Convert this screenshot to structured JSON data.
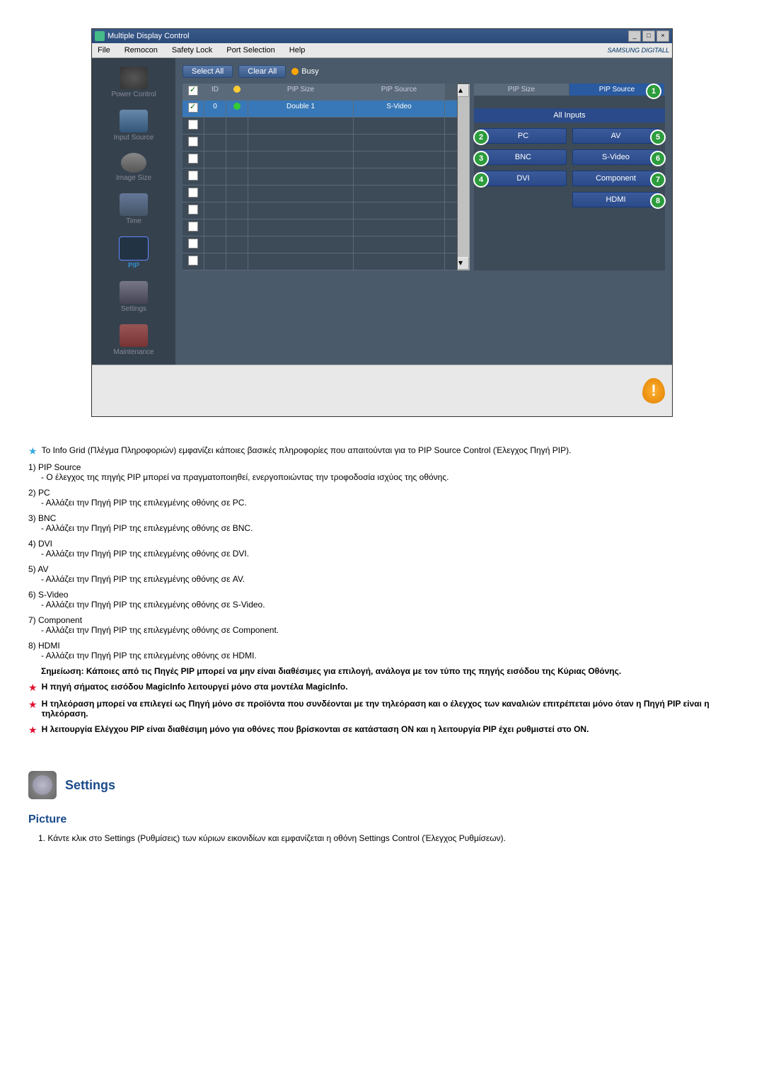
{
  "window": {
    "title": "Multiple Display Control",
    "menu": {
      "file": "File",
      "remocon": "Remocon",
      "safety_lock": "Safety Lock",
      "port_selection": "Port Selection",
      "help": "Help"
    },
    "brand": "SAMSUNG DIGITALL"
  },
  "sidebar": {
    "power": "Power Control",
    "input": "Input Source",
    "image": "Image Size",
    "time": "Time",
    "pip": "PIP",
    "settings": "Settings",
    "maint": "Maintenance"
  },
  "toolbar": {
    "select_all": "Select All",
    "clear_all": "Clear All",
    "busy": "Busy"
  },
  "grid": {
    "headers": {
      "id": "ID",
      "pip_size": "PIP Size",
      "pip_source": "PIP Source"
    },
    "row0": {
      "id": "0",
      "pip_size": "Double 1",
      "pip_source": "S-Video"
    }
  },
  "right_panel": {
    "headers": {
      "pip_size": "PIP Size",
      "pip_source": "PIP Source"
    },
    "all_inputs": "All Inputs",
    "buttons": {
      "pc": "PC",
      "bnc": "BNC",
      "dvi": "DVI",
      "av": "AV",
      "svideo": "S-Video",
      "component": "Component",
      "hdmi": "HDMI"
    },
    "nums": {
      "n1": "1",
      "n2": "2",
      "n3": "3",
      "n4": "4",
      "n5": "5",
      "n6": "6",
      "n7": "7",
      "n8": "8"
    }
  },
  "alert_exclaim": "!",
  "text": {
    "info_grid": "Το Info Grid (Πλέγμα Πληροφοριών) εμφανίζει κάποιες βασικές πληροφορίες που απαιτούνται για το PIP Source Control (Έλεγχος Πηγή PIP).",
    "item1_head": "1) PIP Source",
    "item1_desc": "- Ο έλεγχος της πηγής PIP μπορεί να πραγματοποιηθεί, ενεργοποιώντας την τροφοδοσία ισχύος της οθόνης.",
    "item2_head": "2) PC",
    "item2_desc": "- Αλλάζει την Πηγή PIP της επιλεγμένης οθόνης σε PC.",
    "item3_head": "3) BNC",
    "item3_desc": "- Αλλάζει την Πηγή PIP της επιλεγμένης οθόνης σε BNC.",
    "item4_head": "4) DVI",
    "item4_desc": "- Αλλάζει την Πηγή PIP της επιλεγμένης οθόνης σε DVI.",
    "item5_head": "5) AV",
    "item5_desc": "- Αλλάζει την Πηγή PIP της επιλεγμένης οθόνης σε AV.",
    "item6_head": "6) S-Video",
    "item6_desc": "- Αλλάζει την Πηγή PIP της επιλεγμένης οθόνης σε S-Video.",
    "item7_head": "7) Component",
    "item7_desc": "- Αλλάζει την Πηγή PIP της επιλεγμένης οθόνης σε Component.",
    "item8_head": "8) HDMI",
    "item8_desc": "- Αλλάζει την Πηγή PIP της επιλεγμένης οθόνης σε HDMI.",
    "note": "Σημείωση: Κάποιες από τις Πηγές PIP μπορεί να μην είναι διαθέσιμες για επιλογή, ανάλογα με τον τύπο της πηγής εισόδου της Κύριας Οθόνης.",
    "red1": "Η πηγή σήματος εισόδου MagicInfo λειτουργεί μόνο στα μοντέλα MagicInfo.",
    "red2": "Η τηλεόραση μπορεί να επιλεγεί ως Πηγή μόνο σε προϊόντα που συνδέονται με την τηλεόραση και ο έλεγχος των καναλιών επιτρέπεται μόνο όταν η Πηγή PIP είναι η τηλεόραση.",
    "red3": "Η λειτουργία Ελέγχου PIP είναι διαθέσιμη μόνο για οθόνες που βρίσκονται σε κατάσταση ON και η λειτουργία PIP έχει ρυθμιστεί στο ON."
  },
  "section": {
    "settings_title": "Settings",
    "picture_title": "Picture",
    "step1": "1.  Κάντε κλικ στο Settings (Ρυθμίσεις) των κύριων εικονιδίων και εμφανίζεται η οθόνη Settings Control (Έλεγχος Ρυθμίσεων)."
  }
}
